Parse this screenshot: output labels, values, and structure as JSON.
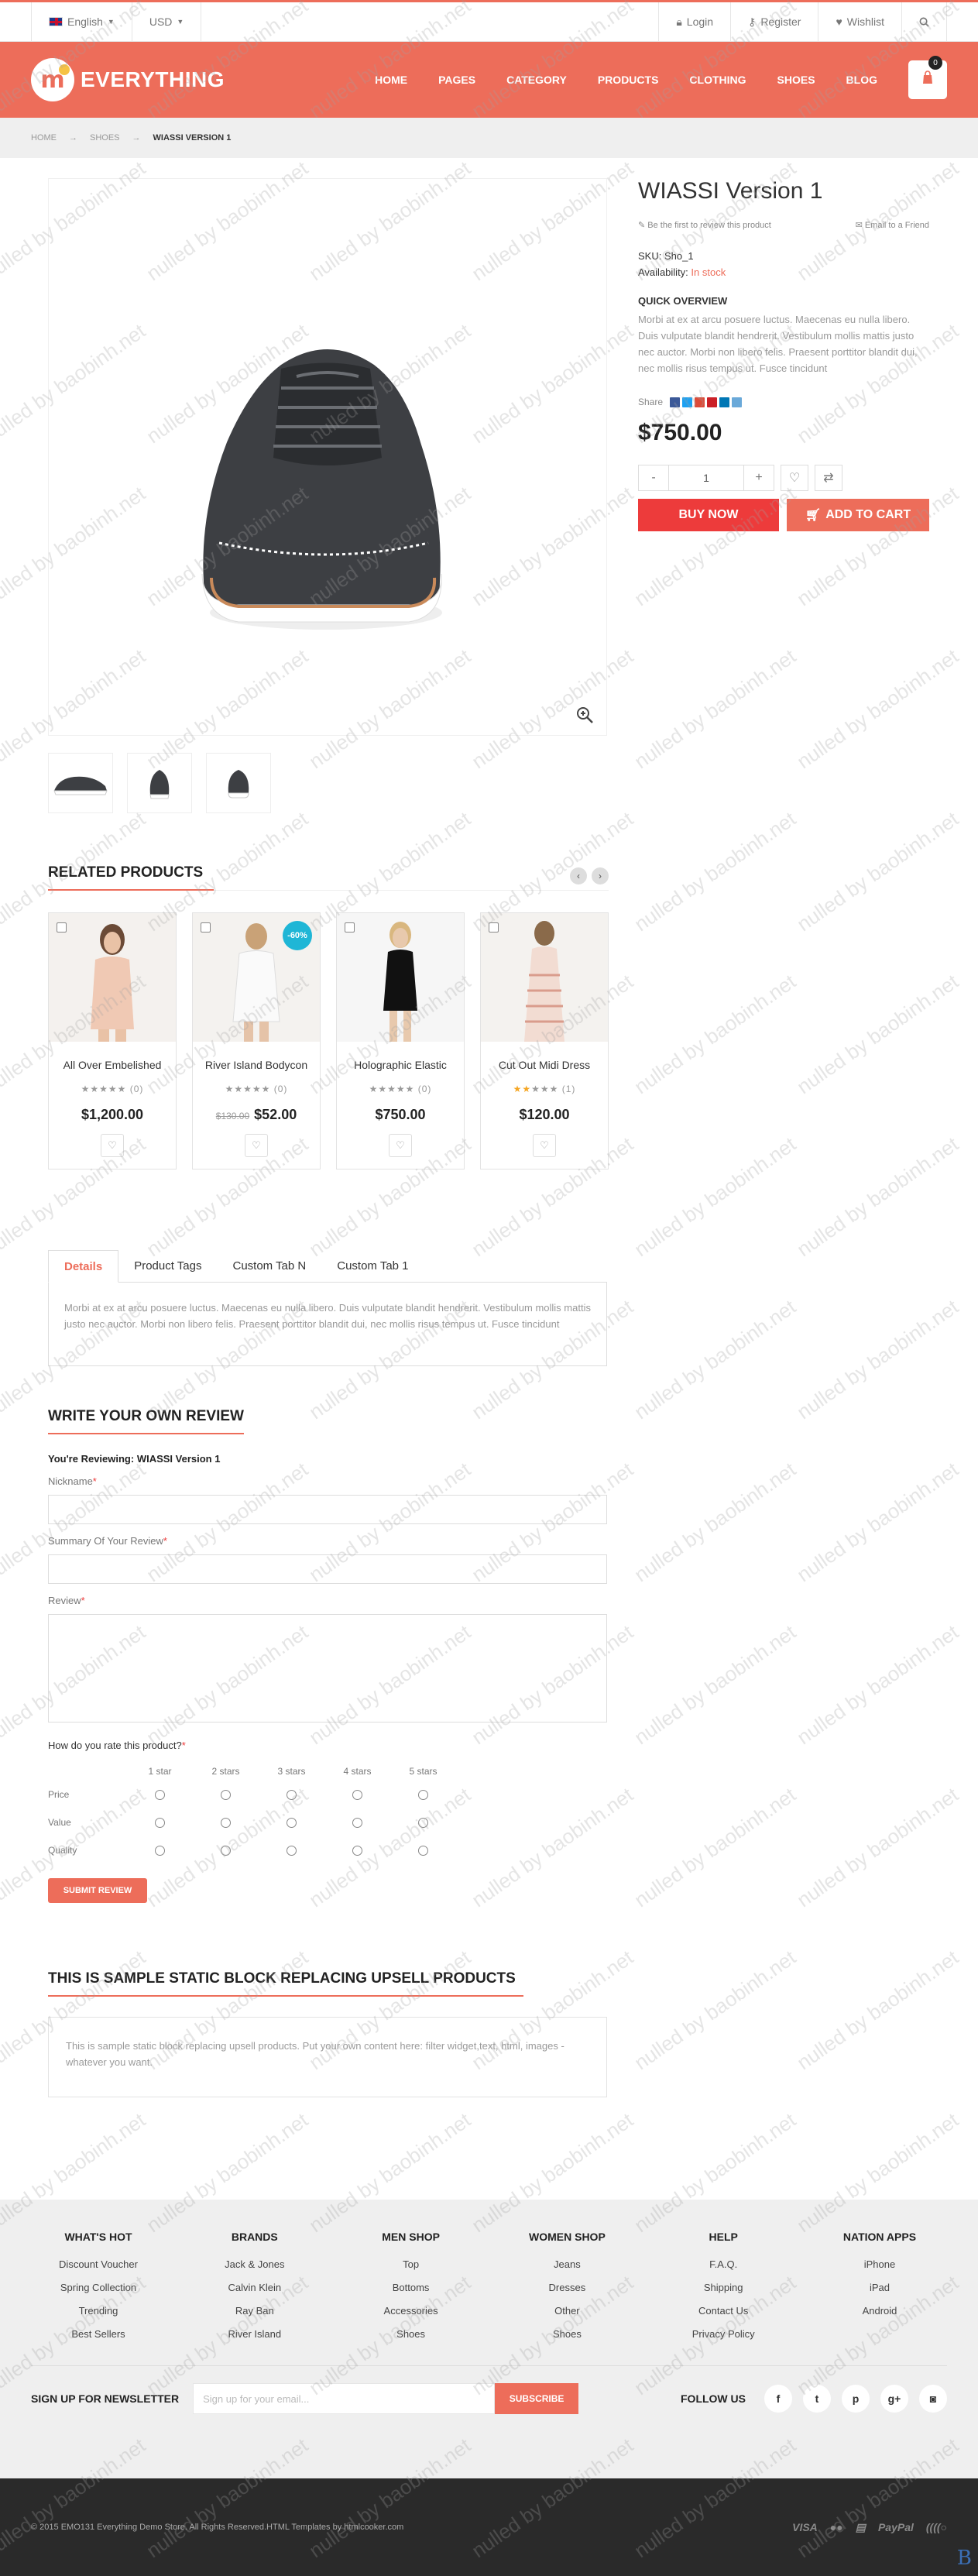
{
  "topbar": {
    "language": "English",
    "currency": "USD",
    "login": "Login",
    "register": "Register",
    "wishlist": "Wishlist"
  },
  "header": {
    "logo_text": "EVERYTHING",
    "nav": [
      "HOME",
      "PAGES",
      "CATEGORY",
      "PRODUCTS",
      "CLOTHING",
      "SHOES",
      "BLOG"
    ],
    "cart_count": "0"
  },
  "breadcrumb": [
    "HOME",
    "SHOES",
    "WIASSI VERSION 1"
  ],
  "product": {
    "title": "WIASSI Version 1",
    "first_review": "Be the first to review this product",
    "email_friend": "Email to a Friend",
    "sku_label": "SKU:",
    "sku": "Sho_1",
    "availability_label": "Availability:",
    "availability": "In stock",
    "quick_overview_title": "QUICK OVERVIEW",
    "quick_overview": "Morbi at ex at arcu posuere luctus. Maecenas eu nulla libero. Duis vulputate blandit hendrerit. Vestibulum mollis mattis justo nec auctor. Morbi non libero felis. Praesent porttitor blandit dui, nec mollis risus tempus ut. Fusce tincidunt",
    "share_label": "Share",
    "price": "$750.00",
    "qty_minus": "-",
    "qty": "1",
    "qty_plus": "+",
    "buy_now": "BUY NOW",
    "add_to_cart": "ADD TO CART"
  },
  "related": {
    "title": "RELATED PRODUCTS",
    "items": [
      {
        "name": "All Over Embelished",
        "rating_count": "(0)",
        "price": "$1,200.00",
        "old_price": "",
        "badge": "",
        "stars": 0
      },
      {
        "name": "River Island Bodycon",
        "rating_count": "(0)",
        "price": "$52.00",
        "old_price": "$130.00",
        "badge": "-60%",
        "stars": 0
      },
      {
        "name": "Holographic Elastic",
        "rating_count": "(0)",
        "price": "$750.00",
        "old_price": "",
        "badge": "",
        "stars": 0
      },
      {
        "name": "Cut Out Midi Dress",
        "rating_count": "(1)",
        "price": "$120.00",
        "old_price": "",
        "badge": "",
        "stars": 2
      }
    ]
  },
  "tabs": {
    "items": [
      "Details",
      "Product Tags",
      "Custom Tab N",
      "Custom Tab 1"
    ],
    "details_text": "Morbi at ex at arcu posuere luctus. Maecenas eu nulla libero. Duis vulputate blandit hendrerit. Vestibulum mollis mattis justo nec auctor. Morbi non libero felis. Praesent porttitor blandit dui, nec mollis risus tempus ut. Fusce tincidunt"
  },
  "review": {
    "title": "WRITE YOUR OWN REVIEW",
    "reviewing": "You're Reviewing: WIASSI Version 1",
    "nickname": "Nickname",
    "summary": "Summary Of Your Review",
    "review": "Review",
    "rate_question": "How do you rate this product?",
    "stars": [
      "1 star",
      "2 stars",
      "3 stars",
      "4 stars",
      "5 stars"
    ],
    "criteria": [
      "Price",
      "Value",
      "Quality"
    ],
    "submit": "SUBMIT REVIEW"
  },
  "static_block": {
    "title": "THIS IS SAMPLE STATIC BLOCK REPLACING UPSELL PRODUCTS",
    "text": "This is sample static block replacing upsell products. Put your own content here: filter widget,text, html, images - whatever you want."
  },
  "footer": {
    "columns": [
      {
        "title": "WHAT'S HOT",
        "links": [
          "Discount Voucher",
          "Spring Collection",
          "Trending",
          "Best Sellers"
        ]
      },
      {
        "title": "BRANDS",
        "links": [
          "Jack & Jones",
          "Calvin Klein",
          "Ray Ban",
          "River Island"
        ]
      },
      {
        "title": "MEN SHOP",
        "links": [
          "Top",
          "Bottoms",
          "Accessories",
          "Shoes"
        ]
      },
      {
        "title": "WOMEN SHOP",
        "links": [
          "Jeans",
          "Dresses",
          "Other",
          "Shoes"
        ]
      },
      {
        "title": "HELP",
        "links": [
          "F.A.Q.",
          "Shipping",
          "Contact Us",
          "Privacy Policy"
        ]
      },
      {
        "title": "NATION APPS",
        "links": [
          "iPhone",
          "iPad",
          "Android"
        ]
      }
    ],
    "newsletter_title": "SIGN UP FOR NEWSLETTER",
    "newsletter_placeholder": "Sign up for your email...",
    "subscribe": "SUBSCRIBE",
    "follow_us": "FOLLOW US",
    "copyright": "© 2015 EMO131 Everything Demo Store. All Rights Reserved.HTML Templates by htmlcooker.com",
    "payments": [
      "VISA",
      "PayPal"
    ]
  },
  "watermark": "nulled by baobinh.net",
  "colors": {
    "accent": "#ed6d5a",
    "buy": "#ed3b3b",
    "badge": "#1fb6d6",
    "instock": "#ed6d5a"
  }
}
